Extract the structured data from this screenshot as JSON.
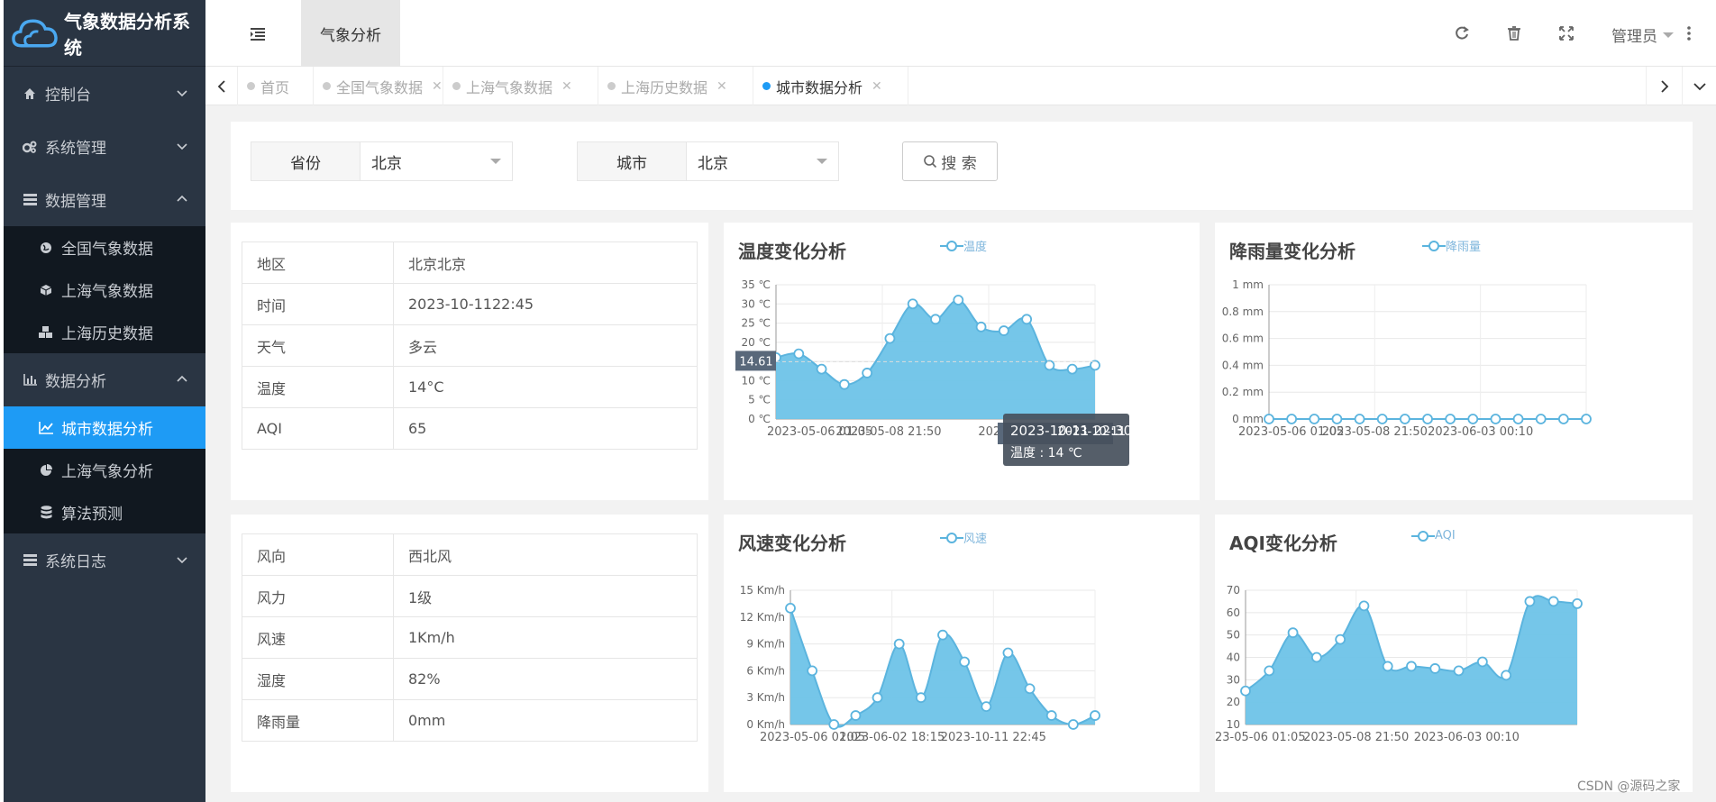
{
  "app": {
    "title": "气象数据分析系统"
  },
  "header": {
    "page_tab": "气象分析",
    "user": "管理员"
  },
  "sidebar": {
    "items": [
      {
        "label": "控制台"
      },
      {
        "label": "系统管理"
      },
      {
        "label": "数据管理",
        "children": [
          {
            "label": "全国气象数据"
          },
          {
            "label": "上海气象数据"
          },
          {
            "label": "上海历史数据"
          }
        ]
      },
      {
        "label": "数据分析",
        "children": [
          {
            "label": "城市数据分析"
          },
          {
            "label": "上海气象分析"
          },
          {
            "label": "算法预测"
          }
        ]
      },
      {
        "label": "系统日志"
      }
    ]
  },
  "tabs": [
    {
      "label": "首页"
    },
    {
      "label": "全国气象数据"
    },
    {
      "label": "上海气象数据"
    },
    {
      "label": "上海历史数据"
    },
    {
      "label": "城市数据分析"
    }
  ],
  "filter": {
    "province_label": "省份",
    "province_value": "北京",
    "city_label": "城市",
    "city_value": "北京",
    "search_label": "搜 索"
  },
  "info_table_1": [
    {
      "k": "地区",
      "v": "北京北京"
    },
    {
      "k": "时间",
      "v": "2023-10-1122:45"
    },
    {
      "k": "天气",
      "v": "多云"
    },
    {
      "k": "温度",
      "v": "14°C"
    },
    {
      "k": "AQI",
      "v": "65"
    }
  ],
  "info_table_2": [
    {
      "k": "风向",
      "v": "西北风"
    },
    {
      "k": "风力",
      "v": "1级"
    },
    {
      "k": "风速",
      "v": "1Km/h"
    },
    {
      "k": "湿度",
      "v": "82%"
    },
    {
      "k": "降雨量",
      "v": "0mm"
    }
  ],
  "watermark": "CSDN @源码之家",
  "colors": {
    "accent": "#1e9bf5",
    "area": "#6ec3e8",
    "line": "#5bb4de",
    "sidebar": "#2a3543"
  },
  "chart_data": [
    {
      "type": "area",
      "title": "温度变化分析",
      "legend": [
        "温度"
      ],
      "yticks": [
        "0 ℃",
        "5 ℃",
        "10 ℃",
        "15 ℃",
        "20 ℃",
        "25 ℃",
        "30 ℃",
        "35 ℃"
      ],
      "ylim": [
        0,
        35
      ],
      "xlabels": [
        "2023-05-06 01:05",
        "2023-05-08 21:50",
        "2023-06-0",
        "2023-10-11 22:30"
      ],
      "series": [
        {
          "name": "温度",
          "values": [
            16,
            17,
            13,
            9,
            12,
            21,
            30,
            26,
            31,
            24,
            23,
            26,
            14,
            13,
            14
          ]
        }
      ],
      "tooltip": {
        "title": "2023-10-11 22:30",
        "line": "温度 : 14 ℃"
      },
      "axis_pointer": "14.61",
      "grid": true
    },
    {
      "type": "line",
      "title": "降雨量变化分析",
      "legend": [
        "降雨量"
      ],
      "yticks": [
        "0 mm",
        "0.2 mm",
        "0.4 mm",
        "0.6 mm",
        "0.8 mm",
        "1 mm"
      ],
      "ylim": [
        0,
        1
      ],
      "xlabels": [
        "2023-05-06 01:05",
        "2023-05-08 21:50",
        "2023-06-03 00:10"
      ],
      "series": [
        {
          "name": "降雨量",
          "values": [
            0,
            0,
            0,
            0,
            0,
            0,
            0,
            0,
            0,
            0,
            0,
            0,
            0,
            0,
            0
          ]
        }
      ],
      "grid": true
    },
    {
      "type": "area",
      "title": "风速变化分析",
      "legend": [
        "风速"
      ],
      "yticks": [
        "0 Km/h",
        "3 Km/h",
        "6 Km/h",
        "9 Km/h",
        "12 Km/h",
        "15 Km/h"
      ],
      "ylim": [
        0,
        15
      ],
      "xlabels": [
        "2023-05-06 01:05",
        "2023-06-02 18:15",
        "2023-10-11 22:45"
      ],
      "series": [
        {
          "name": "风速",
          "values": [
            13,
            6,
            0,
            1,
            3,
            9,
            3,
            10,
            7,
            2,
            8,
            4,
            1,
            0,
            1
          ]
        }
      ],
      "grid": true
    },
    {
      "type": "area",
      "title": "AQI变化分析",
      "legend": [
        "AQI"
      ],
      "yticks": [
        "10",
        "20",
        "30",
        "40",
        "50",
        "60",
        "70"
      ],
      "ylim": [
        10,
        70
      ],
      "xlabels": [
        "23-05-06 01:05",
        "2023-05-08 21:50",
        "2023-06-03 00:10"
      ],
      "series": [
        {
          "name": "AQI",
          "values": [
            25,
            34,
            51,
            40,
            48,
            63,
            36,
            36,
            35,
            34,
            38,
            32,
            65,
            65,
            64
          ]
        }
      ],
      "grid": true
    }
  ]
}
